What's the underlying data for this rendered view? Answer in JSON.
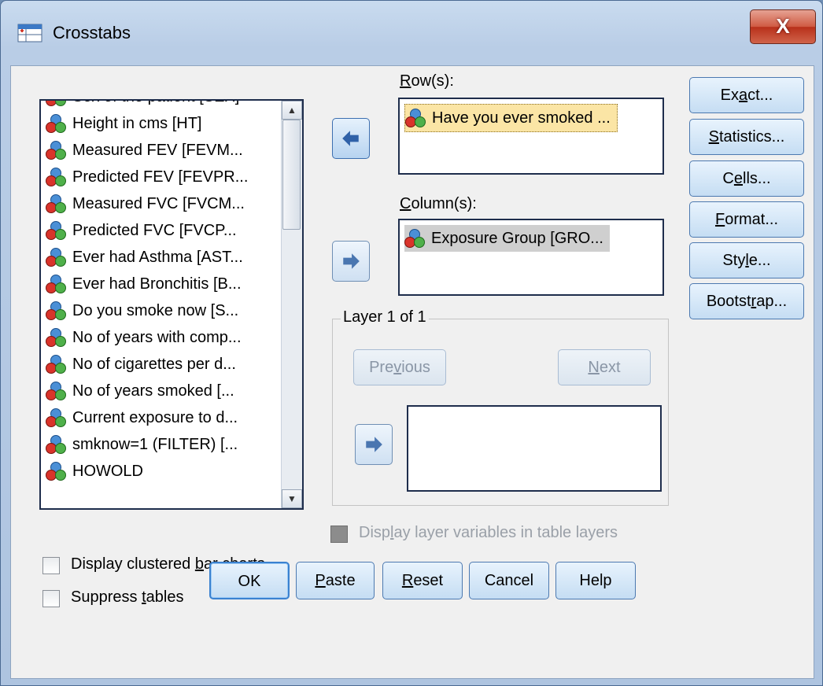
{
  "window": {
    "title": "Crosstabs",
    "close_glyph": "X"
  },
  "variable_list": {
    "items": [
      {
        "label": "Sex of the patient [SEX]",
        "icon": "nominal-variable-icon"
      },
      {
        "label": "Height in cms [HT]",
        "icon": "nominal-variable-icon"
      },
      {
        "label": "Measured FEV [FEVM...",
        "icon": "nominal-variable-icon"
      },
      {
        "label": "Predicted FEV [FEVPR...",
        "icon": "nominal-variable-icon"
      },
      {
        "label": "Measured FVC [FVCM...",
        "icon": "nominal-variable-icon"
      },
      {
        "label": "Predicted FVC [FVCP...",
        "icon": "nominal-variable-icon"
      },
      {
        "label": "Ever had Asthma [AST...",
        "icon": "nominal-variable-icon"
      },
      {
        "label": "Ever had Bronchitis [B...",
        "icon": "nominal-variable-icon"
      },
      {
        "label": "Do you smoke now [S...",
        "icon": "nominal-variable-icon"
      },
      {
        "label": "No of years with comp...",
        "icon": "nominal-variable-icon"
      },
      {
        "label": "No of cigarettes per d...",
        "icon": "nominal-variable-icon"
      },
      {
        "label": "No of years smoked [...",
        "icon": "nominal-variable-icon"
      },
      {
        "label": "Current exposure to d...",
        "icon": "nominal-variable-icon"
      },
      {
        "label": "smknow=1 (FILTER) [...",
        "icon": "nominal-variable-icon"
      },
      {
        "label": "HOWOLD",
        "icon": "nominal-variable-icon"
      }
    ]
  },
  "rows": {
    "label_pre": "",
    "label_ul": "R",
    "label_post": "ow(s):",
    "item": "Have you ever smoked ..."
  },
  "columns": {
    "label_pre": "",
    "label_ul": "C",
    "label_post": "olumn(s):",
    "item": "Exposure Group [GRO..."
  },
  "layer": {
    "legend": "Layer 1 of 1",
    "previous_pre": "Pre",
    "previous_ul": "v",
    "previous_post": "ious",
    "next_pre": "",
    "next_ul": "N",
    "next_post": "ext"
  },
  "display_layer": {
    "pre": "Disp",
    "ul": "l",
    "post": "ay layer variables in table layers",
    "checked": true,
    "enabled": false
  },
  "options": {
    "clustered": {
      "pre": "Display clustered ",
      "ul": "b",
      "post": "ar charts",
      "checked": false
    },
    "suppress": {
      "pre": "Suppress ",
      "ul": "t",
      "post": "ables",
      "checked": false
    }
  },
  "side_buttons": {
    "exact": {
      "pre": "Ex",
      "ul": "a",
      "post": "ct..."
    },
    "statistics": {
      "pre": "",
      "ul": "S",
      "post": "tatistics..."
    },
    "cells": {
      "pre": "C",
      "ul": "e",
      "post": "lls..."
    },
    "format": {
      "pre": "",
      "ul": "F",
      "post": "ormat..."
    },
    "style": {
      "pre": "Sty",
      "ul": "l",
      "post": "e..."
    },
    "bootstrap": {
      "pre": "Bootst",
      "ul": "r",
      "post": "ap..."
    }
  },
  "bottom_buttons": {
    "ok": {
      "pre": "OK",
      "ul": "",
      "post": ""
    },
    "paste": {
      "pre": "",
      "ul": "P",
      "post": "aste"
    },
    "reset": {
      "pre": "",
      "ul": "R",
      "post": "eset"
    },
    "cancel": {
      "pre": "Cancel",
      "ul": "",
      "post": ""
    },
    "help": {
      "pre": "Help",
      "ul": "",
      "post": ""
    }
  },
  "colors": {
    "accent": "#3b82d0",
    "selection": "#fbe5a5",
    "close": "#c8452e"
  }
}
